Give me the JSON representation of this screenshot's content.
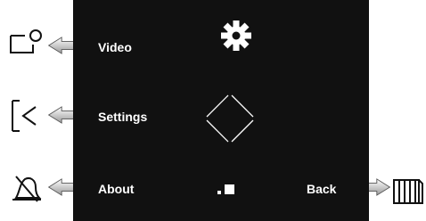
{
  "softkeys": {
    "video_label": "Video",
    "settings_label": "Settings",
    "about_label": "About",
    "back_label": "Back"
  },
  "colors": {
    "screen": "#111111",
    "text": "#ffffff",
    "arrow_light": "#f2f2f2",
    "arrow_dark": "#9a9a9a",
    "outline": "#111111"
  },
  "icons": {
    "center_top": "gear-icon",
    "center_middle": "diamond-navigation-icon",
    "center_bottom": "progress-indicator-icon",
    "left_top": "video-camera-icon",
    "left_middle": "back-bracket-icon",
    "left_bottom": "muted-bell-icon",
    "right_bottom": "gate-icon"
  }
}
